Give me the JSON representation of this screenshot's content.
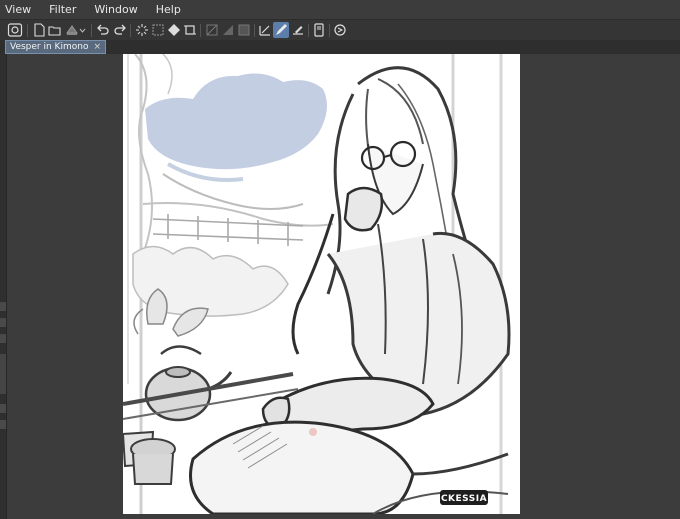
{
  "menu": {
    "items": [
      "View",
      "Filter",
      "Window",
      "Help"
    ]
  },
  "toolbar": {
    "buttons": [
      "app-icon",
      "new-file-icon",
      "open-folder-icon",
      "save-icon",
      "dropdown-icon",
      "undo-icon",
      "redo-icon",
      "loading-icon",
      "transform-icon",
      "fill-icon",
      "crop-icon",
      "selection-icon",
      "tone-icon",
      "frame-icon",
      "ruler-icon",
      "pen-active-icon",
      "correction-icon",
      "device-icon",
      "rotate-icon"
    ],
    "active_button": "pen-active-icon"
  },
  "document": {
    "tab_title": "Vesper in Kimono",
    "close_symbol": "×"
  },
  "artwork": {
    "subject": "sketch",
    "signature": "CKESSIA"
  },
  "colors": {
    "menubar": "#3c3c3c",
    "toolbar": "#353535",
    "workspace": "#3c3c3c",
    "tab_active": "#5a6a7e",
    "sky_wash": "#b8c6de"
  }
}
